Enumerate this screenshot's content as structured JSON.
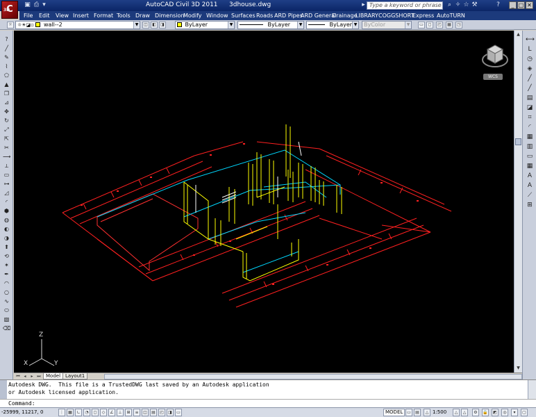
{
  "title_bar": {
    "app_title": "AutoCAD Civil 3D 2011",
    "file_name": "3dhouse.dwg",
    "search_placeholder": "Type a keyword or phrase",
    "logo_letter": "C",
    "logo_version": "3D"
  },
  "menu": {
    "items": [
      "File",
      "Edit",
      "View",
      "Insert",
      "Format",
      "Tools",
      "Draw",
      "Dimension",
      "Modify",
      "Window",
      "Surfaces",
      "Roads",
      "ARD Pipes",
      "ARD General",
      "Drainage",
      "LIBRARY",
      "COGGSHORT",
      "Express",
      "AutoTURN"
    ]
  },
  "toolbar": {
    "layer_name": "wall--2",
    "color_value": "ByLayer",
    "linetype_value": "ByLayer",
    "lineweight_value": "ByLayer",
    "plotstyle_value": "ByColor"
  },
  "viewcube": {
    "wcs_label": "WCS"
  },
  "ucs": {
    "z": "Z",
    "y": "Y",
    "x": "X"
  },
  "layout_tabs": {
    "model": "Model",
    "layout1": "Layout1"
  },
  "command_window": {
    "line1": "Autodesk DWG.  This file is a TrustedDWG last saved by an Autodesk application",
    "line2": "or Autodesk licensed application.",
    "prompt": "Command:"
  },
  "status_bar": {
    "coordinates": "-25999, 11217, 0",
    "model_label": "MODEL",
    "annotation_scale": "1:500"
  },
  "colors": {
    "titlebar": "#0b2566",
    "drawing_bg": "#000000",
    "dim_red": "#ff2020",
    "wall_yellow": "#ffff00",
    "wall_cyan": "#00d8ff"
  }
}
